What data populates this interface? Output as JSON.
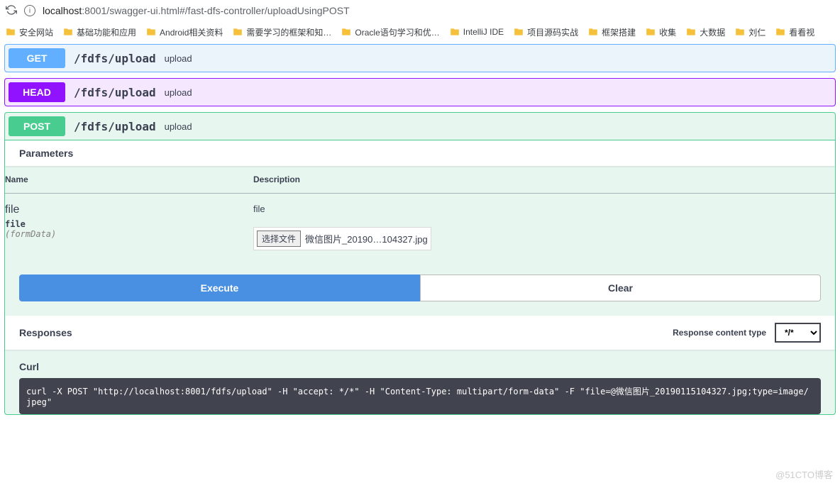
{
  "browser": {
    "url_host": "localhost",
    "url_rest": ":8001/swagger-ui.html#/fast-dfs-controller/uploadUsingPOST"
  },
  "bookmarks": [
    "安全网站",
    "基础功能和应用",
    "Android相关资料",
    "需要学习的框架和知…",
    "Oracle语句学习和优…",
    "IntelliJ IDE",
    "项目源码实战",
    "框架搭建",
    "收集",
    "大数据",
    "刘仁",
    "看看视"
  ],
  "ops": {
    "get": {
      "method": "GET",
      "path": "/fdfs/upload",
      "desc": "upload"
    },
    "head": {
      "method": "HEAD",
      "path": "/fdfs/upload",
      "desc": "upload"
    },
    "post": {
      "method": "POST",
      "path": "/fdfs/upload",
      "desc": "upload"
    }
  },
  "params": {
    "section_title": "Parameters",
    "col_name": "Name",
    "col_desc": "Description",
    "row": {
      "name": "file",
      "type": "file",
      "in": "(formData)",
      "desc": "file",
      "file_btn": "选择文件",
      "file_name": "微信图片_20190…104327.jpg"
    }
  },
  "buttons": {
    "execute": "Execute",
    "clear": "Clear"
  },
  "responses": {
    "title": "Responses",
    "ct_label": "Response content type",
    "ct_value": "*/*"
  },
  "curl": {
    "title": "Curl",
    "cmd": "curl -X POST \"http://localhost:8001/fdfs/upload\" -H \"accept: */*\" -H \"Content-Type: multipart/form-data\" -F \"file=@微信图片_20190115104327.jpg;type=image/jpeg\""
  },
  "watermark": "@51CTO博客"
}
